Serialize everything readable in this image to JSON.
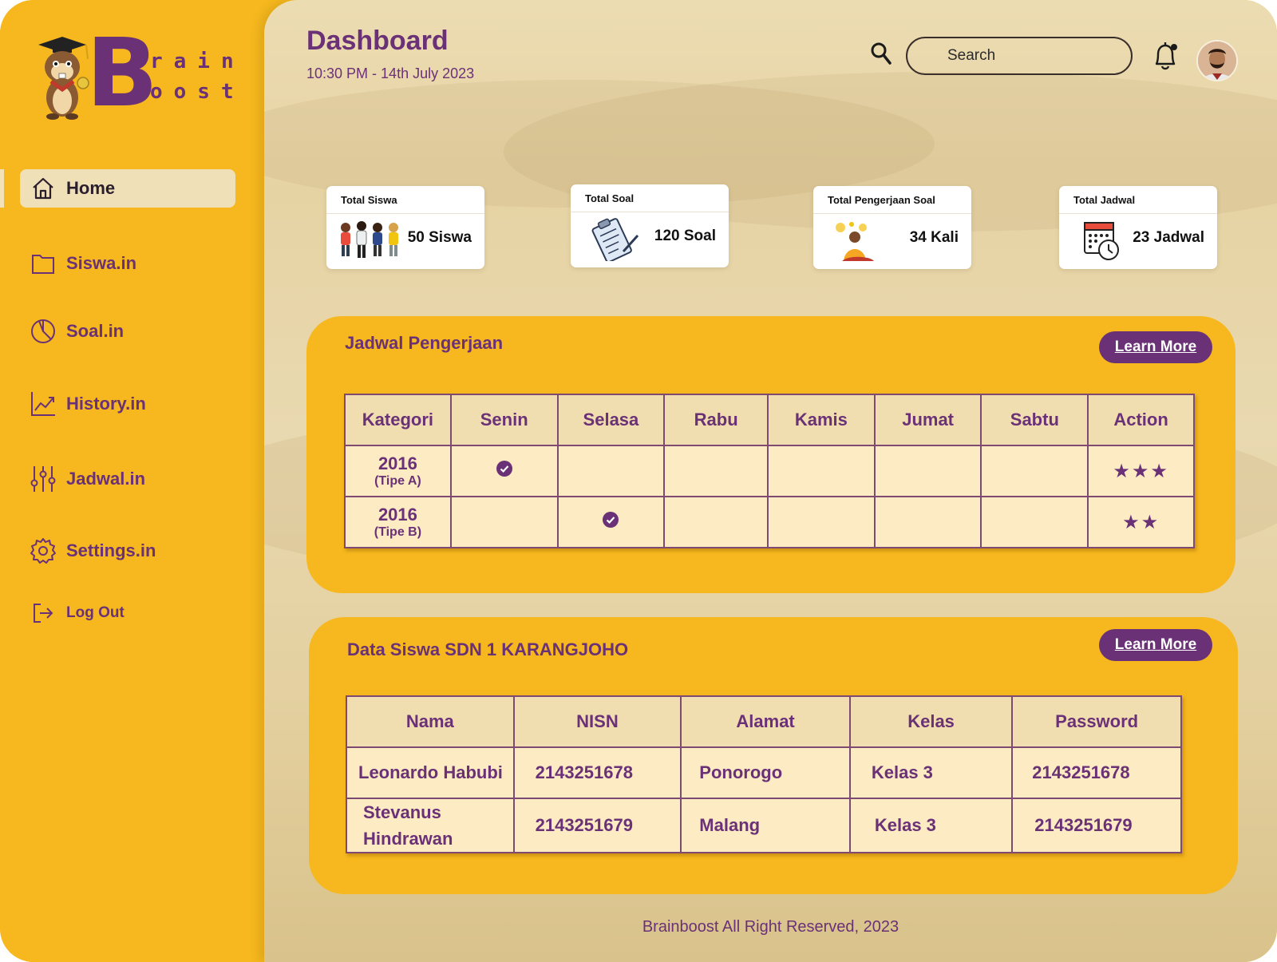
{
  "brand": {
    "line1": "rain",
    "line2": "oost",
    "initial": "B"
  },
  "nav": {
    "items": [
      {
        "label": "Home",
        "icon": "home-icon"
      },
      {
        "label": "Siswa.in",
        "icon": "folder-icon"
      },
      {
        "label": "Soal.in",
        "icon": "pie-chart-icon"
      },
      {
        "label": "History.in",
        "icon": "line-chart-icon"
      },
      {
        "label": "Jadwal.in",
        "icon": "sliders-icon"
      },
      {
        "label": "Settings.in",
        "icon": "gear-icon"
      },
      {
        "label": "Log Out",
        "icon": "logout-icon"
      }
    ]
  },
  "header": {
    "title": "Dashboard",
    "datetime": "10:30 PM - 14th July 2023",
    "search_placeholder": "Search"
  },
  "stats": [
    {
      "title": "Total Siswa",
      "value": "50 Siswa",
      "icon": "students-icon"
    },
    {
      "title": "Total Soal",
      "value": "120 Soal",
      "icon": "clipboard-icon"
    },
    {
      "title": "Total Pengerjaan Soal",
      "value": "34 Kali",
      "icon": "thinking-person-icon"
    },
    {
      "title": "Total Jadwal",
      "value": "23 Jadwal",
      "icon": "calendar-clock-icon"
    }
  ],
  "schedule": {
    "title": "Jadwal Pengerjaan",
    "button": "Learn More",
    "columns": [
      "Kategori",
      "Senin",
      "Selasa",
      "Rabu",
      "Kamis",
      "Jumat",
      "Sabtu",
      "Action"
    ],
    "rows": [
      {
        "year": "2016",
        "type": "(Tipe A)",
        "rating": "★★★"
      },
      {
        "year": "2016",
        "type": "(Tipe B)",
        "rating": "★★"
      }
    ]
  },
  "students": {
    "title": "Data Siswa SDN 1 KARANGJOHO",
    "button": "Learn More",
    "columns": [
      "Nama",
      "NISN",
      "Alamat",
      "Kelas",
      "Password"
    ],
    "rows": [
      {
        "nama": "Leonardo Habubi",
        "nisn": "2143251678",
        "alamat": "Ponorogo",
        "kelas": "Kelas 3",
        "password": "2143251678"
      },
      {
        "nama": "Stevanus Hindrawan",
        "nisn": "2143251679",
        "alamat": "Malang",
        "kelas": "Kelas 3",
        "password": "2143251679"
      }
    ]
  },
  "footer": "Brainboost All Right Reserved, 2023",
  "colors": {
    "primary": "#6a3176",
    "accent": "#f6b81e",
    "cell": "#fdebc3",
    "header_cell": "#f1deb0"
  }
}
